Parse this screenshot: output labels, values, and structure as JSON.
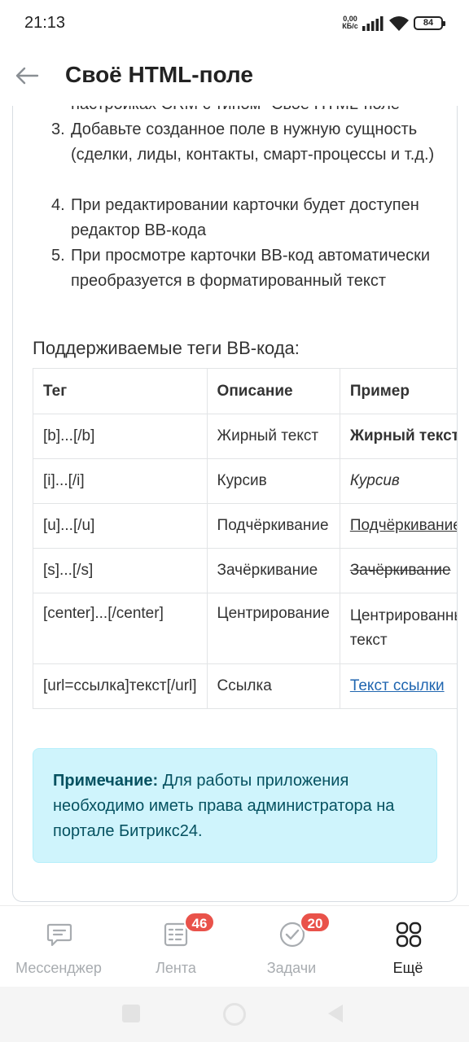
{
  "status_bar": {
    "time": "21:13",
    "net_speed_value": "0,00",
    "net_speed_unit": "КБ/с",
    "battery": "84"
  },
  "header": {
    "title": "Своё HTML-поле",
    "back_icon": "arrow-left-icon"
  },
  "steps": [
    {
      "num": "",
      "text": "настройках CRM с типом \"Свое HTML-поле\""
    },
    {
      "num": "3.",
      "text": "Добавьте созданное поле в нужную сущность (сделки, лиды, контакты, смарт-процессы и т.д.)"
    },
    {
      "num": "4.",
      "text": "При редактировании карточки будет доступен редактор BB-кода"
    },
    {
      "num": "5.",
      "text": "При просмотре карточки BB-код автоматически преобразуется в форматированный текст"
    }
  ],
  "tags_section": {
    "title": "Поддерживаемые теги BB-кода:",
    "columns": [
      "Тег",
      "Описание",
      "Пример"
    ],
    "rows": [
      {
        "tag": "[b]...[/b]",
        "description": "Жирный текст",
        "example": "Жирный текст"
      },
      {
        "tag": "[i]...[/i]",
        "description": "Курсив",
        "example": "Курсив"
      },
      {
        "tag": "[u]...[/u]",
        "description": "Подчёркивание",
        "example": "Подчёркивание"
      },
      {
        "tag": "[s]...[/s]",
        "description": "Зачёркивание",
        "example": "Зачёркивание"
      },
      {
        "tag": "[center]...[/center]",
        "description": "Центрирование",
        "example": "Центрированный текст"
      },
      {
        "tag": "[url=ссылка]текст[/url]",
        "description": "Ссылка",
        "example": "Текст ссылки"
      }
    ]
  },
  "note": {
    "label": "Примечание:",
    "text": " Для работы приложения необходимо иметь права администратора на портале Битрикс24."
  },
  "bottom_nav": [
    {
      "label": "Мессенджер",
      "icon": "chat-icon",
      "badge": ""
    },
    {
      "label": "Лента",
      "icon": "feed-icon",
      "badge": "46"
    },
    {
      "label": "Задачи",
      "icon": "check-circle-icon",
      "badge": "20"
    },
    {
      "label": "Ещё",
      "icon": "grid-icon",
      "badge": ""
    }
  ],
  "colors": {
    "note_bg": "#cff4fc",
    "note_text": "#055160",
    "badge": "#e9524a",
    "link": "#2066b0"
  }
}
